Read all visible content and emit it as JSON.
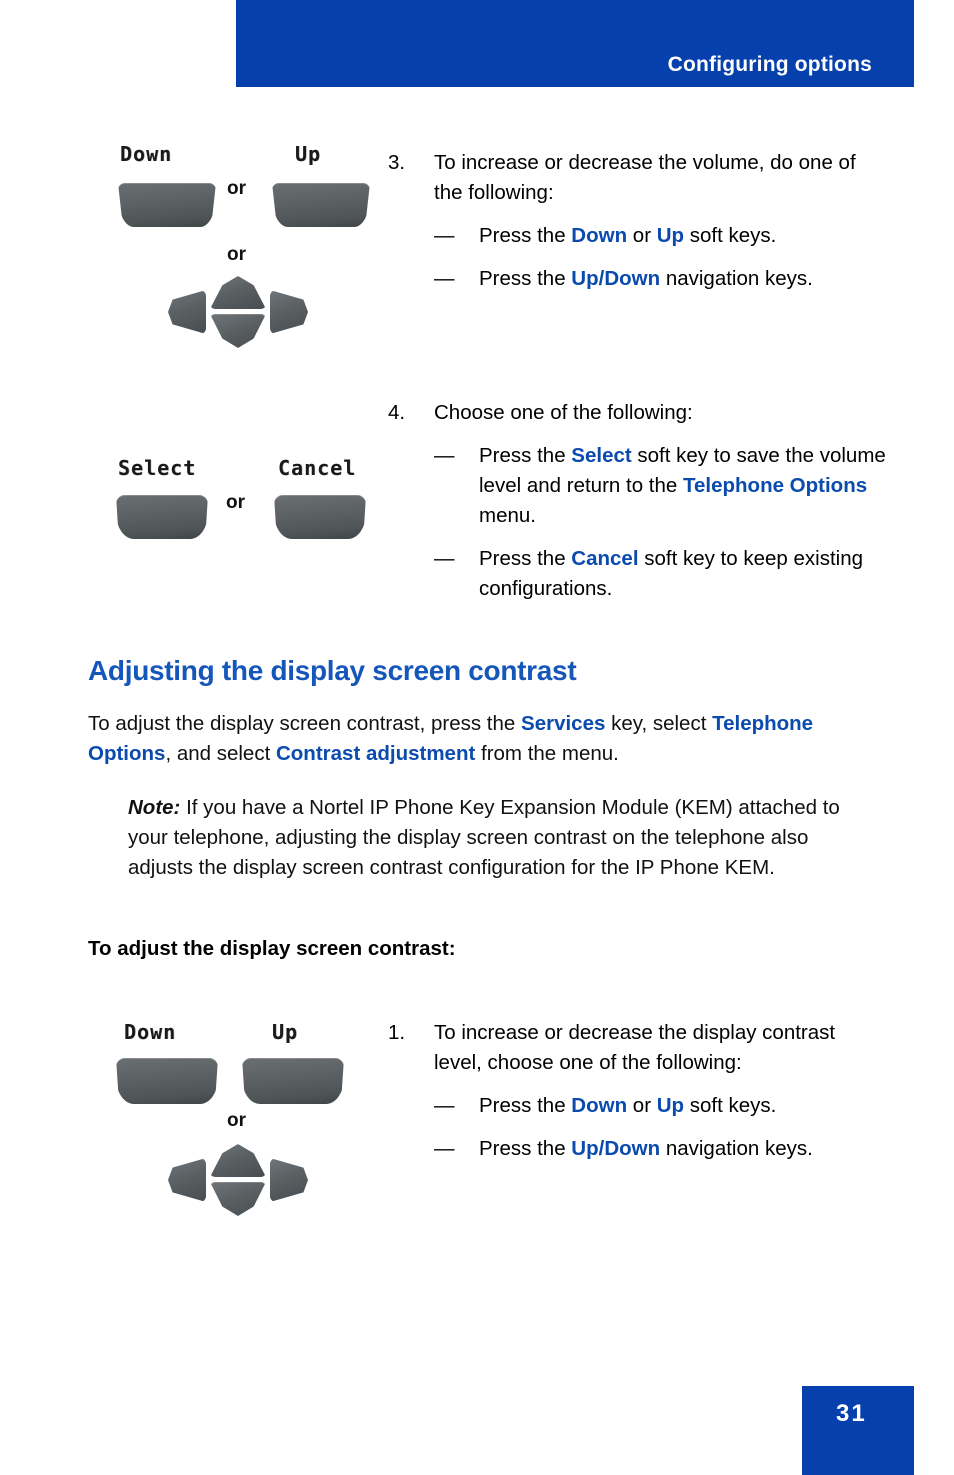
{
  "header": {
    "title": "Configuring options",
    "banner_color": "#0640ac"
  },
  "footer": {
    "page_number": "31",
    "box_color": "#0640ac"
  },
  "theme": {
    "link_blue": "#0b4bae",
    "heading_blue": "#1556ba",
    "key_gray": "#5b6063"
  },
  "illustration_top": {
    "softkey_down_label": "Down",
    "softkey_up_label": "Up",
    "or_between": "or",
    "or_below": "or",
    "nav_keys": [
      "left",
      "up",
      "down",
      "right"
    ]
  },
  "illustration_middle": {
    "softkey_select_label": "Select",
    "softkey_cancel_label": "Cancel",
    "or_between": "or"
  },
  "illustration_bottom": {
    "softkey_down_label": "Down",
    "softkey_up_label": "Up",
    "or_below": "or",
    "nav_keys": [
      "left",
      "up",
      "down",
      "right"
    ]
  },
  "step3": {
    "number": "3.",
    "intro": "To increase or decrease the volume, do one of the following:",
    "items": [
      {
        "dash": "—",
        "parts": [
          {
            "text": "Press the ",
            "style": "normal"
          },
          {
            "text": "Down",
            "style": "blue"
          },
          {
            "text": " or ",
            "style": "normal"
          },
          {
            "text": "Up",
            "style": "blue"
          },
          {
            "text": " soft keys.",
            "style": "normal"
          }
        ]
      },
      {
        "dash": "—",
        "parts": [
          {
            "text": "Press the ",
            "style": "normal"
          },
          {
            "text": "Up/Down",
            "style": "blue"
          },
          {
            "text": " navigation keys.",
            "style": "normal"
          }
        ]
      }
    ]
  },
  "step4": {
    "number": "4.",
    "intro": "Choose one of the following:",
    "items": [
      {
        "dash": "—",
        "parts": [
          {
            "text": "Press the ",
            "style": "normal"
          },
          {
            "text": "Select",
            "style": "blue"
          },
          {
            "text": " soft key to save the volume level and return to the ",
            "style": "normal"
          },
          {
            "text": "Telephone Options",
            "style": "blue"
          },
          {
            "text": " menu.",
            "style": "normal"
          }
        ]
      },
      {
        "dash": "—",
        "parts": [
          {
            "text": "Press the ",
            "style": "normal"
          },
          {
            "text": "Cancel",
            "style": "blue"
          },
          {
            "text": " soft key to keep existing configurations.",
            "style": "normal"
          }
        ]
      }
    ]
  },
  "section": {
    "heading": "Adjusting the display screen contrast",
    "intro_parts": [
      {
        "text": "To adjust the display screen contrast, press the ",
        "style": "normal"
      },
      {
        "text": "Services",
        "style": "blue"
      },
      {
        "text": " key, select ",
        "style": "normal"
      },
      {
        "text": "Telephone Options",
        "style": "blue"
      },
      {
        "text": ", and select ",
        "style": "normal"
      },
      {
        "text": "Contrast adjustment",
        "style": "blue"
      },
      {
        "text": " from the menu.",
        "style": "normal"
      }
    ],
    "note_label": "Note:",
    "note_text": " If you have a Nortel IP Phone  Key Expansion Module (KEM) attached to your telephone, adjusting the display screen contrast on the telephone also adjusts the display screen contrast configuration for the IP Phone KEM.",
    "procedure_heading": "To adjust the display screen contrast:"
  },
  "step1": {
    "number": "1.",
    "intro": "To increase or decrease the display contrast level, choose one of the following:",
    "items": [
      {
        "dash": "—",
        "parts": [
          {
            "text": "Press the ",
            "style": "normal"
          },
          {
            "text": "Down",
            "style": "blue"
          },
          {
            "text": " or ",
            "style": "normal"
          },
          {
            "text": "Up",
            "style": "blue"
          },
          {
            "text": " soft keys.",
            "style": "normal"
          }
        ]
      },
      {
        "dash": "—",
        "parts": [
          {
            "text": "Press the ",
            "style": "normal"
          },
          {
            "text": "Up/Down",
            "style": "blue"
          },
          {
            "text": " navigation keys.",
            "style": "normal"
          }
        ]
      }
    ]
  }
}
